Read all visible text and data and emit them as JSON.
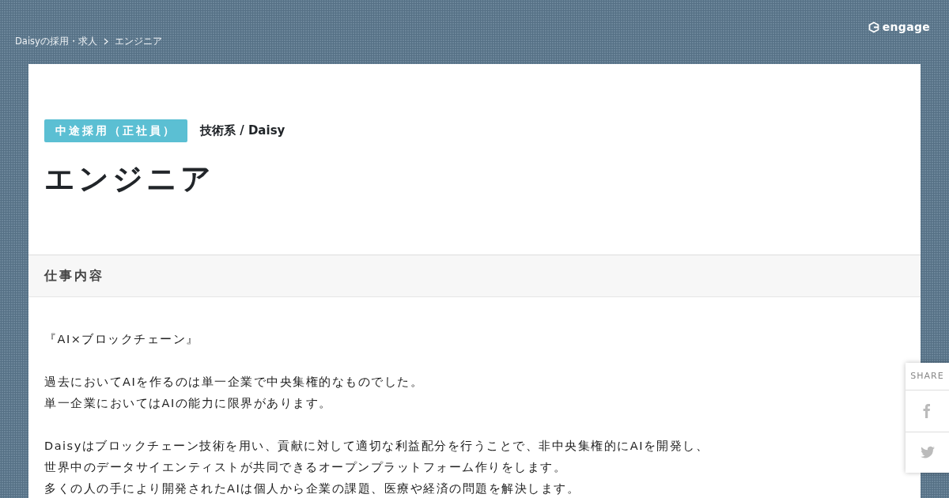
{
  "breadcrumb": [
    "Daisyの採用・求人",
    "エンジニア"
  ],
  "logo": {
    "text": "engage"
  },
  "job": {
    "employment_type": "中途採用（正社員）",
    "category": "技術系 / Daisy",
    "title": "エンジニア"
  },
  "section": {
    "heading": "仕事内容",
    "paragraphs": [
      [
        "『AI×ブロックチェーン』"
      ],
      [
        "過去においてAIを作るのは単一企業で中央集権的なものでした。",
        "単一企業においてはAIの能力に限界があります。"
      ],
      [
        "Daisyはブロックチェーン技術を用い、貢献に対して適切な利益配分を行うことで、非中央集権的にAIを開発し、",
        "世界中のデータサイエンティストが共同できるオープンプラットフォーム作りをします。",
        "多くの人の手により開発されたAIは個人から企業の課題、医療や経済の問題を解決します。"
      ]
    ]
  },
  "share": {
    "label": "SHARE",
    "buttons": [
      {
        "kind": "facebook"
      },
      {
        "kind": "twitter"
      }
    ]
  }
}
